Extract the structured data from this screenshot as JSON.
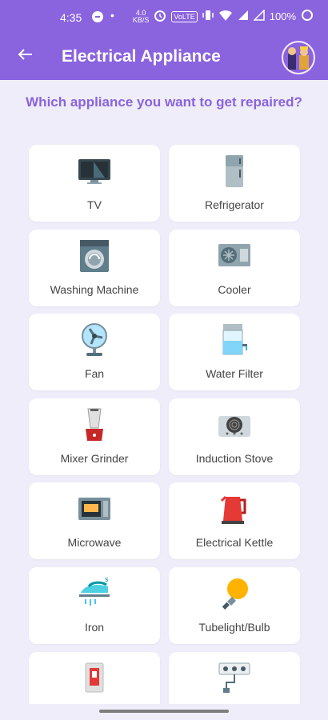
{
  "status": {
    "time": "4:35",
    "speed_top": "4.0",
    "speed_bottom": "KB/S",
    "network": "VoLTE",
    "battery": "100%"
  },
  "appbar": {
    "title": "Electrical Appliance"
  },
  "question": "Which appliance you want to get repaired?",
  "items": [
    {
      "label": "TV",
      "icon": "tv-icon"
    },
    {
      "label": "Refrigerator",
      "icon": "refrigerator-icon"
    },
    {
      "label": "Washing Machine",
      "icon": "washing-machine-icon"
    },
    {
      "label": "Cooler",
      "icon": "cooler-icon"
    },
    {
      "label": "Fan",
      "icon": "fan-icon"
    },
    {
      "label": "Water Filter",
      "icon": "water-filter-icon"
    },
    {
      "label": "Mixer Grinder",
      "icon": "mixer-grinder-icon"
    },
    {
      "label": "Induction Stove",
      "icon": "induction-stove-icon"
    },
    {
      "label": "Microwave",
      "icon": "microwave-icon"
    },
    {
      "label": "Electrical Kettle",
      "icon": "kettle-icon"
    },
    {
      "label": "Iron",
      "icon": "iron-icon"
    },
    {
      "label": "Tubelight/Bulb",
      "icon": "bulb-icon"
    },
    {
      "label": "",
      "icon": "switch-icon"
    },
    {
      "label": "",
      "icon": "extension-board-icon"
    }
  ]
}
